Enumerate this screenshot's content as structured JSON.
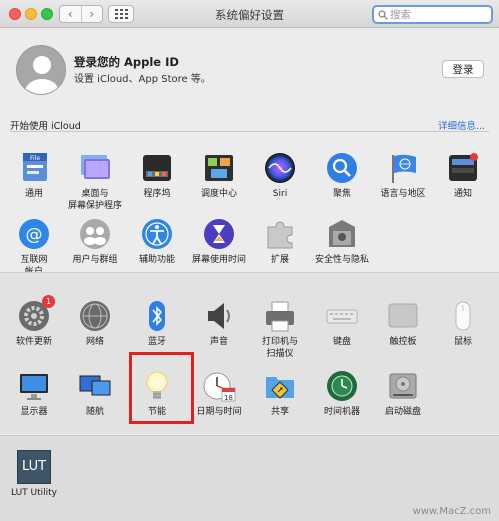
{
  "window": {
    "title": "系统偏好设置"
  },
  "toolbar": {
    "back_glyph": "‹",
    "forward_glyph": "›"
  },
  "search": {
    "placeholder": "搜索",
    "value": ""
  },
  "account": {
    "title": "登录您的 Apple ID",
    "subtitle": "设置 iCloud、App Store 等。",
    "login_label": "登录",
    "icloud_label": "开始使用 iCloud",
    "details_label": "详细信息..."
  },
  "panes_row1": [
    {
      "label": "通用",
      "icon": "general-icon"
    },
    {
      "label": "桌面与\n屏幕保护程序",
      "icon": "desktop-icon"
    },
    {
      "label": "程序坞",
      "icon": "dock-icon"
    },
    {
      "label": "调度中心",
      "icon": "mission-control-icon"
    },
    {
      "label": "Siri",
      "icon": "siri-icon"
    },
    {
      "label": "聚焦",
      "icon": "spotlight-icon"
    },
    {
      "label": "语言与地区",
      "icon": "language-icon"
    },
    {
      "label": "通知",
      "icon": "notifications-icon"
    }
  ],
  "panes_row2": [
    {
      "label": "互联网\n帐户",
      "icon": "internet-accounts-icon"
    },
    {
      "label": "用户与群组",
      "icon": "users-icon"
    },
    {
      "label": "辅助功能",
      "icon": "accessibility-icon"
    },
    {
      "label": "屏幕使用时间",
      "icon": "screen-time-icon"
    },
    {
      "label": "扩展",
      "icon": "extensions-icon"
    },
    {
      "label": "安全性与隐私",
      "icon": "security-icon"
    }
  ],
  "panes_row3": [
    {
      "label": "软件更新",
      "icon": "software-update-icon",
      "badge": "1"
    },
    {
      "label": "网络",
      "icon": "network-icon"
    },
    {
      "label": "蓝牙",
      "icon": "bluetooth-icon"
    },
    {
      "label": "声音",
      "icon": "sound-icon"
    },
    {
      "label": "打印机与\n扫描仪",
      "icon": "printer-icon"
    },
    {
      "label": "键盘",
      "icon": "keyboard-icon"
    },
    {
      "label": "触控板",
      "icon": "trackpad-icon"
    },
    {
      "label": "鼠标",
      "icon": "mouse-icon"
    }
  ],
  "panes_row4": [
    {
      "label": "显示器",
      "icon": "display-icon"
    },
    {
      "label": "随航",
      "icon": "sidecar-icon"
    },
    {
      "label": "节能",
      "icon": "energy-saver-icon"
    },
    {
      "label": "日期与时间",
      "icon": "date-time-icon",
      "day": "18"
    },
    {
      "label": "共享",
      "icon": "sharing-icon"
    },
    {
      "label": "时间机器",
      "icon": "time-machine-icon"
    },
    {
      "label": "启动磁盘",
      "icon": "startup-disk-icon"
    }
  ],
  "third_party": [
    {
      "label": "LUT Utility",
      "icon_text": "LUT",
      "icon": "lut-utility-icon"
    }
  ],
  "watermark": "www.MacZ.com",
  "colors": {
    "highlight": "#e0211f",
    "link": "#2a6ad8",
    "search_focus": "#6d9be2"
  }
}
